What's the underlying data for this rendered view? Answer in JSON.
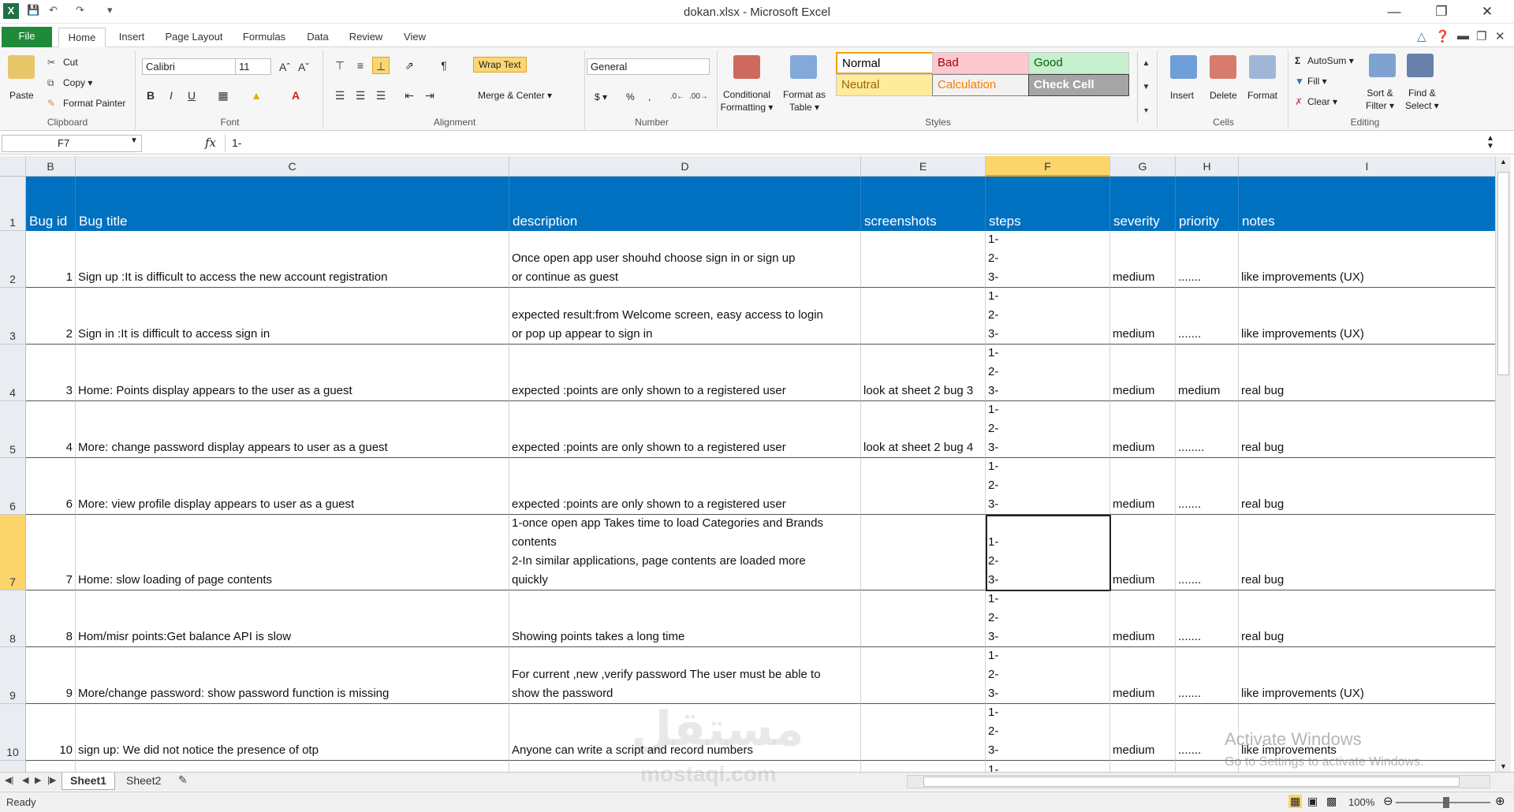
{
  "window": {
    "title": "dokan.xlsx - Microsoft Excel",
    "minimize": "—",
    "restore": "❐",
    "close": "✕"
  },
  "tabs": [
    "File",
    "Home",
    "Insert",
    "Page Layout",
    "Formulas",
    "Data",
    "Review",
    "View"
  ],
  "ribbon": {
    "clipboard": {
      "paste": "Paste",
      "cut": "Cut",
      "copy": "Copy ▾",
      "format_painter": "Format Painter",
      "label": "Clipboard"
    },
    "font": {
      "name": "Calibri",
      "size": "11",
      "label": "Font",
      "bold": "B",
      "italic": "I",
      "underline": "U"
    },
    "alignment": {
      "wrap_text": "Wrap Text",
      "merge_center": "Merge & Center ▾",
      "label": "Alignment"
    },
    "number": {
      "format": "General",
      "currency": "$ ▾",
      "percent": "%",
      "comma": ",",
      "label": "Number"
    },
    "styles": {
      "conditional": "Conditional\nFormatting ▾",
      "format_table": "Format as\nTable ▾",
      "cells": [
        {
          "name": "Normal",
          "bg": "#ffffff",
          "fg": "#000000",
          "border": "#f2a100"
        },
        {
          "name": "Bad",
          "bg": "#ffc7ce",
          "fg": "#9c0006",
          "border": "#c8c8c8"
        },
        {
          "name": "Good",
          "bg": "#c6efce",
          "fg": "#006100",
          "border": "#c8c8c8"
        },
        {
          "name": "Neutral",
          "bg": "#ffeb9c",
          "fg": "#9c6500",
          "border": "#c8c8c8"
        },
        {
          "name": "Calculation",
          "bg": "#f2f2f2",
          "fg": "#fa7d00",
          "border": "#7f7f7f"
        },
        {
          "name": "Check Cell",
          "bg": "#a5a5a5",
          "fg": "#ffffff",
          "border": "#3f3f3f"
        }
      ],
      "label": "Styles"
    },
    "cells": {
      "insert": "Insert",
      "delete": "Delete",
      "format": "Format",
      "label": "Cells"
    },
    "editing": {
      "autosum": "AutoSum ▾",
      "fill": "Fill ▾",
      "clear": "Clear ▾",
      "sort_filter": "Sort &\nFilter ▾",
      "find_select": "Find &\nSelect ▾",
      "label": "Editing"
    }
  },
  "formula_bar": {
    "name_box": "F7",
    "fx": "fx",
    "formula": "1-"
  },
  "columns": [
    {
      "letter": "B",
      "selected": false
    },
    {
      "letter": "C",
      "selected": false
    },
    {
      "letter": "D",
      "selected": false
    },
    {
      "letter": "E",
      "selected": false
    },
    {
      "letter": "F",
      "selected": true
    },
    {
      "letter": "G",
      "selected": false
    },
    {
      "letter": "H",
      "selected": false
    },
    {
      "letter": "I",
      "selected": false
    }
  ],
  "header_row": {
    "row": "1",
    "cells": [
      "Bug id",
      "Bug title",
      "description",
      "screenshots",
      "steps",
      "severity",
      "priority",
      "notes"
    ]
  },
  "rows": [
    {
      "row": "2",
      "id": "1",
      "title": "Sign up :It is difficult to access the new account registration",
      "description": "Once open app  user shouhd choose   sign in or sign up\nor continue as guest",
      "screenshots": "",
      "steps": "1-\n2-\n3-",
      "severity": "medium",
      "priority": ".......",
      "notes": "like improvements  (UX)"
    },
    {
      "row": "3",
      "id": "2",
      "title": "Sign in :It is difficult to access  sign in",
      "description": " expected result:from Welcome screen, easy access to login\nor pop up appear to sign in",
      "screenshots": "",
      "steps": "1-\n2-\n3-",
      "severity": "medium",
      "priority": ".......",
      "notes": "like improvements  (UX)"
    },
    {
      "row": "4",
      "id": "3",
      "title": "Home: Points display appears to the user as a guest",
      "description": "expected :points are only shown to a registered user",
      "screenshots": "look at sheet 2 bug 3",
      "steps": "1-\n2-\n3-",
      "severity": "medium",
      "priority": "medium",
      "notes": "real bug"
    },
    {
      "row": "5",
      "id": "4",
      "title": "More: change password display appears to  user as a guest",
      "description": "expected :points are only shown to a registered user",
      "screenshots": "look at sheet 2 bug 4",
      "steps": "1-\n2-\n3-",
      "severity": "medium",
      "priority": "........",
      "notes": "real bug"
    },
    {
      "row": "6",
      "id": "6",
      "title": "More: view profile display appears to  user as a guest",
      "description": "expected :points are only shown to a registered user",
      "screenshots": "",
      "steps": "1-\n2-\n3-",
      "severity": "medium",
      "priority": ".......",
      "notes": "real bug"
    },
    {
      "row": "7",
      "id": "7",
      "title": "Home: slow loading of page contents",
      "description": "1-once open app Takes time to load Categories and Brands\n  contents\n2-In similar applications, page contents are loaded more\nquickly",
      "screenshots": "",
      "steps": "1-\n2-\n3-",
      "severity": "medium",
      "priority": ".......",
      "notes": "real bug"
    },
    {
      "row": "8",
      "id": "8",
      "title": "Hom/misr points:Get balance API is slow",
      "description": "Showing points takes a long time",
      "screenshots": "",
      "steps": "1-\n2-\n3-",
      "severity": "medium",
      "priority": ".......",
      "notes": "real bug"
    },
    {
      "row": "9",
      "id": "9",
      "title": "More/change password: show password function is missing",
      "description": "For current ,new ,verify password The user must be able to\n show the password",
      "screenshots": "",
      "steps": "1-\n2-\n3-",
      "severity": "medium",
      "priority": ".......",
      "notes": "like improvements  (UX)"
    },
    {
      "row": "10",
      "id": "10",
      "title": "sign up: We did not notice the presence of otp",
      "description": "Anyone can write a script and record numbers",
      "screenshots": "",
      "steps": "1-\n2-\n3-",
      "severity": "medium",
      "priority": ".......",
      "notes": "like improvements"
    },
    {
      "row": "",
      "id": "",
      "title": "",
      "description": "",
      "screenshots": "",
      "steps": "1-",
      "severity": "",
      "priority": "",
      "notes": ""
    }
  ],
  "sheets": [
    {
      "name": "Sheet1",
      "active": true
    },
    {
      "name": "Sheet2",
      "active": false
    }
  ],
  "status": {
    "text": "Ready",
    "zoom": "100%"
  },
  "overlay": {
    "watermark": "مستقل",
    "watermark_sub": "mostaql.com",
    "activate_title": "Activate Windows",
    "activate_sub": "Go to Settings to activate Windows."
  }
}
